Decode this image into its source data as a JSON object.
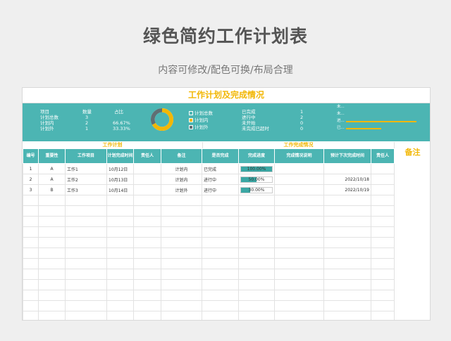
{
  "promo": {
    "title": "绿色简约工作计划表",
    "subtitle": "内容可修改/配色可换/布局合理"
  },
  "sheet": {
    "title": "工作计划及完成情况",
    "summary": {
      "headers": [
        "项目",
        "数量",
        "占比"
      ],
      "rows": [
        {
          "label": "计划总数",
          "count": "3",
          "ratio": ""
        },
        {
          "label": "计划内",
          "count": "2",
          "ratio": "66.67%"
        },
        {
          "label": "计划外",
          "count": "1",
          "ratio": "33.33%"
        }
      ],
      "legend": [
        "计划总数",
        "计划内",
        "计划外"
      ],
      "donut": {
        "in_plan": 66.67,
        "out_plan": 33.33
      },
      "status_rows": [
        {
          "label": "已完成",
          "count": "1"
        },
        {
          "label": "进行中",
          "count": "2"
        },
        {
          "label": "未开始",
          "count": "0"
        },
        {
          "label": "未完成已超时",
          "count": "0"
        }
      ],
      "bar_labels": [
        "未...",
        "未...",
        "进...",
        "已..."
      ],
      "bar_values": [
        0,
        0,
        2,
        1
      ]
    },
    "sections": {
      "plan": "工作计划",
      "completion": "工作完成情况",
      "notes": "备注"
    },
    "columns": [
      "编号",
      "重要性",
      "工作项目",
      "计划完成时间",
      "责任人",
      "备注",
      "是否完成",
      "完成进度",
      "完成情况说明",
      "预计下次完成时间",
      "责任人"
    ],
    "rows": [
      {
        "no": "1",
        "importance": "A",
        "item": "工作1",
        "plan_date": "10月12日",
        "owner": "",
        "note": "计划内",
        "done": "已完成",
        "progress": "100.00%",
        "progress_value": 1.0,
        "desc": "",
        "next_date": "",
        "owner2": ""
      },
      {
        "no": "2",
        "importance": "A",
        "item": "工作2",
        "plan_date": "10月13日",
        "owner": "",
        "note": "计划内",
        "done": "进行中",
        "progress": "50.00%",
        "progress_value": 0.5,
        "desc": "",
        "next_date": "2022/10/18",
        "owner2": ""
      },
      {
        "no": "3",
        "importance": "B",
        "item": "工作3",
        "plan_date": "10月14日",
        "owner": "",
        "note": "计划外",
        "done": "进行中",
        "progress": "30.00%",
        "progress_value": 0.3,
        "desc": "",
        "next_date": "2022/10/19",
        "owner2": ""
      }
    ],
    "empty_rows": 12
  }
}
